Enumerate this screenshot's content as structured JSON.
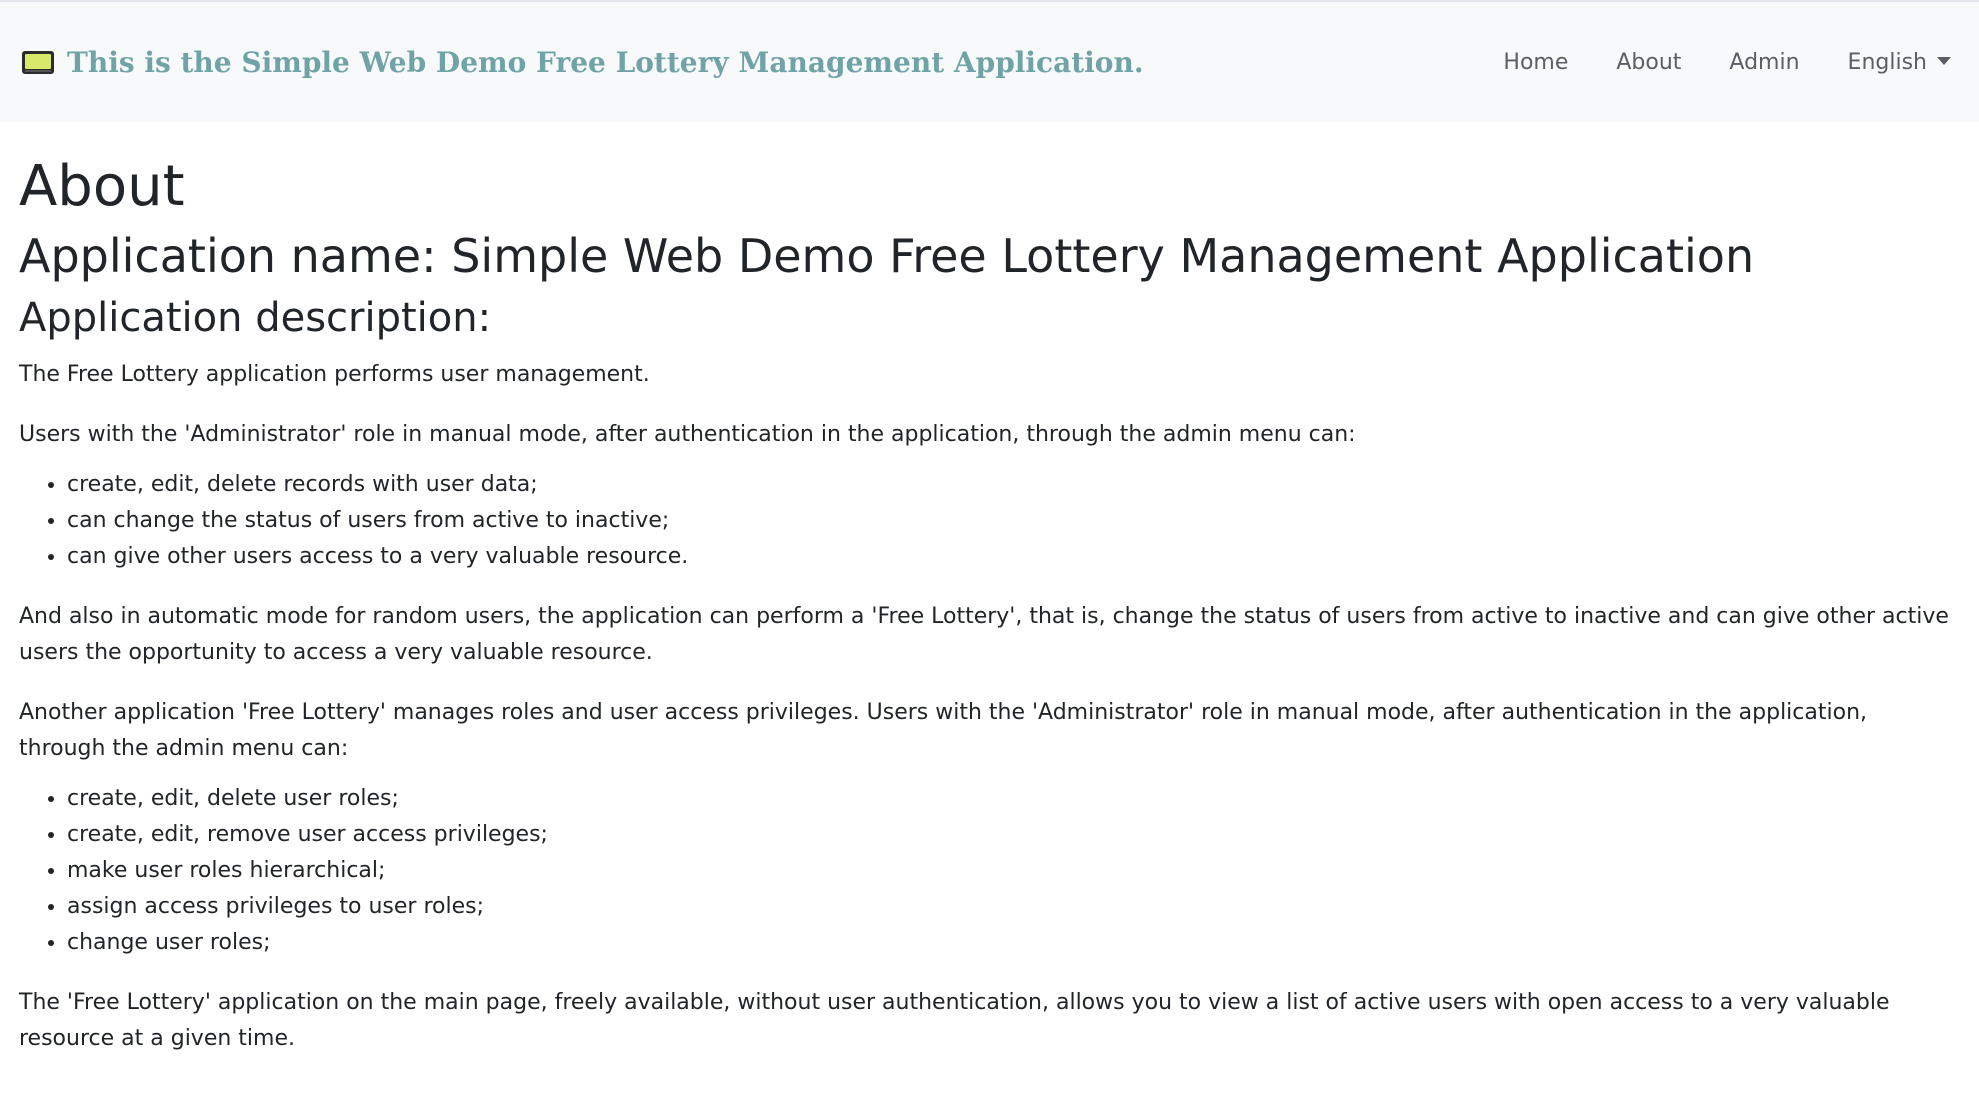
{
  "navbar": {
    "brand_icon": "monitor-icon",
    "brand_text": "This is the Simple Web Demo Free Lottery Management Application.",
    "links": {
      "home": "Home",
      "about": "About",
      "admin": "Admin",
      "language": "English"
    }
  },
  "page": {
    "title": "About",
    "app_name": "Application name: Simple Web Demo Free Lottery Management Application",
    "description_heading": "Application description:",
    "p1": "The Free Lottery application performs user management.",
    "p2": "Users with the 'Administrator' role in manual mode, after authentication in the application, through the admin menu can:",
    "list1": [
      "create, edit, delete records with user data;",
      "can change the status of users from active to inactive;",
      "can give other users access to a very valuable resource."
    ],
    "p3": "And also in automatic mode for random users, the application can perform a 'Free Lottery', that is, change the status of users from active to inactive and can give other active users the opportunity to access a very valuable resource.",
    "p4": "Another application 'Free Lottery' manages roles and user access privileges. Users with the 'Administrator' role in manual mode, after authentication in the application, through the admin menu can:",
    "list2": [
      "create, edit, delete user roles;",
      "create, edit, remove user access privileges;",
      "make user roles hierarchical;",
      "assign access privileges to user roles;",
      "change user roles;"
    ],
    "p5": "The 'Free Lottery' application on the main page, freely available, without user authentication, allows you to view a list of active users with open access to a very valuable resource at a given time."
  },
  "colors": {
    "brand": "#6fa3a6",
    "navbar_bg": "#f8f9fa",
    "nav_link": "#5a5f66",
    "text": "#212529"
  }
}
